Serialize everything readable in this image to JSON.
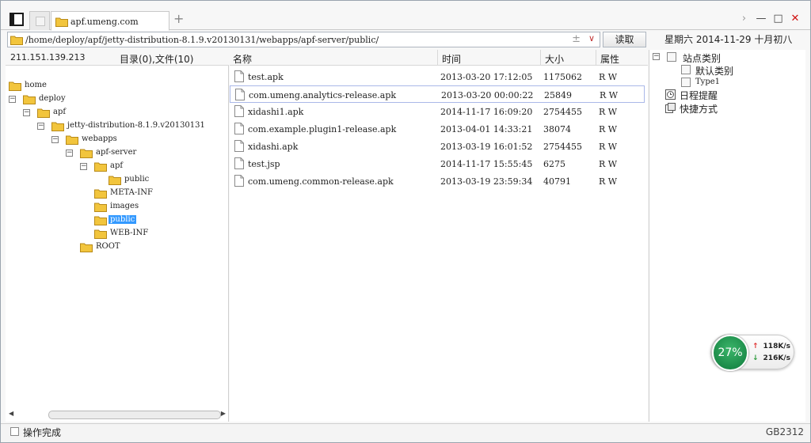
{
  "tabbar": {
    "active_tab_label": "apf.umeng.com",
    "add_tab_glyph": "+",
    "chevron_glyph": "›",
    "minimize_glyph": "—",
    "maximize_glyph": "□",
    "close_glyph": "✕"
  },
  "address": {
    "path": "/home/deploy/apf/jetty-distribution-8.1.9.v20130131/webapps/apf-server/public/",
    "plus_minus_glyph": "±",
    "dropdown_glyph": "∨",
    "read_button": "读取"
  },
  "date_display": "星期六 2014-11-29 十月初八",
  "left_panel": {
    "ip": "211.151.139.213",
    "counts": "目录(0),文件(10)",
    "tree": [
      {
        "label": "home",
        "toggle": ""
      },
      {
        "label": "deploy",
        "toggle": "−"
      },
      {
        "label": "apf",
        "toggle": "−"
      },
      {
        "label": "jetty-distribution-8.1.9.v20130131",
        "toggle": "−"
      },
      {
        "label": "webapps",
        "toggle": "−"
      },
      {
        "label": "apf-server",
        "toggle": "−"
      },
      {
        "label": "apf",
        "toggle": "−"
      },
      {
        "label": "public",
        "toggle": ""
      },
      {
        "label": "META-INF",
        "toggle": ""
      },
      {
        "label": "images",
        "toggle": ""
      },
      {
        "label": "public",
        "toggle": "",
        "selected": true
      },
      {
        "label": "WEB-INF",
        "toggle": ""
      },
      {
        "label": "ROOT",
        "toggle": ""
      }
    ]
  },
  "file_list": {
    "columns": {
      "name": "名称",
      "time": "时间",
      "size": "大小",
      "attr": "属性"
    },
    "rows": [
      {
        "name": "test.apk",
        "time": "2013-03-20 17:12:05",
        "size": "1175062",
        "attr": "R W"
      },
      {
        "name": "com.umeng.analytics-release.apk",
        "time": "2013-03-20 00:00:22",
        "size": "25849",
        "attr": "R W"
      },
      {
        "name": "xidashi1.apk",
        "time": "2014-11-17 16:09:20",
        "size": "2754455",
        "attr": "R W"
      },
      {
        "name": "com.example.plugin1-release.apk",
        "time": "2013-04-01 14:33:21",
        "size": "38074",
        "attr": "R W"
      },
      {
        "name": "xidashi.apk",
        "time": "2013-03-19 16:01:52",
        "size": "2754455",
        "attr": "R W"
      },
      {
        "name": "test.jsp",
        "time": "2014-11-17 15:55:45",
        "size": "6275",
        "attr": "R W"
      },
      {
        "name": "com.umeng.common-release.apk",
        "time": "2013-03-19 23:59:34",
        "size": "40791",
        "attr": "R W"
      }
    ]
  },
  "right_panel": {
    "site_category": "站点类别",
    "default_category": "默认类别",
    "type1": "Type1",
    "schedule": "日程提醒",
    "shortcut": "快捷方式"
  },
  "network_widget": {
    "percent": "27%",
    "up_speed": "118K/s",
    "down_speed": "216K/s",
    "up_arrow": "↑",
    "down_arrow": "↓"
  },
  "status": {
    "text": "操作完成",
    "encoding": "GB2312"
  },
  "colors": {
    "selection": "#3399ff",
    "folder": "#f2c53d",
    "network_green": "#1a8a48",
    "close_red": "#d01010"
  }
}
